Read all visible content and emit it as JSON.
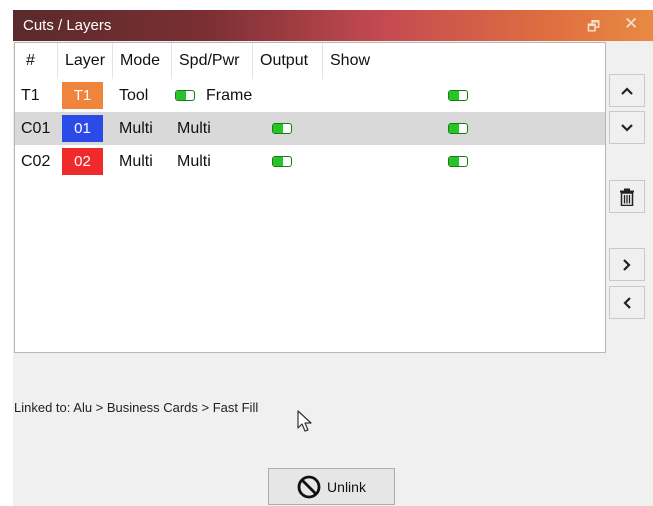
{
  "window": {
    "title": "Cuts / Layers",
    "restore_icon": "restore-icon",
    "close_icon": "close-icon"
  },
  "table": {
    "columns": [
      "#",
      "Layer",
      "Mode",
      "Spd/Pwr",
      "Output",
      "Show"
    ],
    "rows": [
      {
        "id": "T1",
        "layer": "T1",
        "layer_color": "#f0843c",
        "mode": "Tool",
        "spdpwr": "Frame",
        "spdpwr_toggle": true,
        "output_toggle": false,
        "show_toggle": true,
        "selected": false
      },
      {
        "id": "C01",
        "layer": "01",
        "layer_color": "#2a4be8",
        "mode": "Multi",
        "spdpwr": "Multi",
        "spdpwr_toggle": false,
        "output_toggle": true,
        "show_toggle": true,
        "selected": true
      },
      {
        "id": "C02",
        "layer": "02",
        "layer_color": "#f02a2a",
        "mode": "Multi",
        "spdpwr": "Multi",
        "spdpwr_toggle": false,
        "output_toggle": true,
        "show_toggle": true,
        "selected": false
      }
    ]
  },
  "side_buttons": [
    "move-up",
    "move-down",
    "delete",
    "move-right",
    "move-left"
  ],
  "linked_text": "Linked to: Alu > Business Cards > Fast Fill",
  "unlink_label": "Unlink"
}
